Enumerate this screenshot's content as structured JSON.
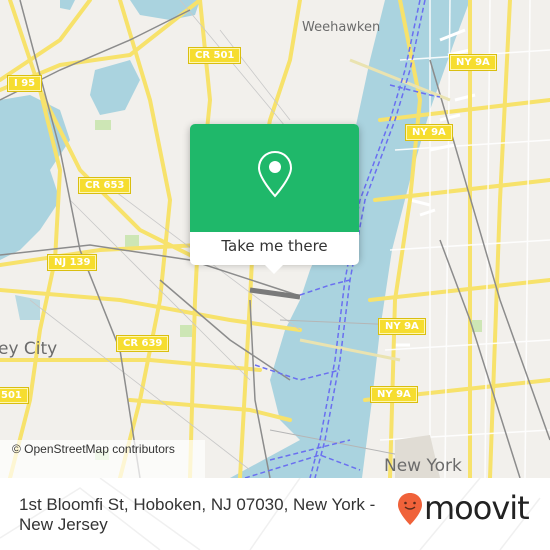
{
  "map": {
    "colors": {
      "land": "#f2f0ec",
      "water": "#aad3df",
      "road": "#f7e26b",
      "rail": "#8c8c8c",
      "ferry": "#6a6ff0",
      "park": "#cde6b5"
    },
    "shields": [
      {
        "label": "CR 501",
        "name": "shield-cr-501-north"
      },
      {
        "label": "I 95",
        "name": "shield-i-95"
      },
      {
        "label": "CR 653",
        "name": "shield-cr-653"
      },
      {
        "label": "NJ 139",
        "name": "shield-nj-139"
      },
      {
        "label": "CR 639",
        "name": "shield-cr-639"
      },
      {
        "label": "501",
        "name": "shield-cr-501-south"
      },
      {
        "label": "NY 9A",
        "name": "shield-ny-9a-1"
      },
      {
        "label": "NY 9A",
        "name": "shield-ny-9a-2"
      },
      {
        "label": "NY 9A",
        "name": "shield-ny-9a-3"
      },
      {
        "label": "NY 9A",
        "name": "shield-ny-9a-4"
      }
    ],
    "places": {
      "weehawken": "Weehawken",
      "jersey_city": "ey City",
      "new_york": "New York"
    },
    "attribution": "© OpenStreetMap contributors"
  },
  "popup": {
    "icon": "map-pin-icon",
    "button_label": "Take me there",
    "color": "#1fb86a"
  },
  "footer": {
    "address": "1st Bloomfi St, Hoboken, NJ 07030, New York - New Jersey",
    "brand": "moovit",
    "brand_color": "#f0623a"
  }
}
